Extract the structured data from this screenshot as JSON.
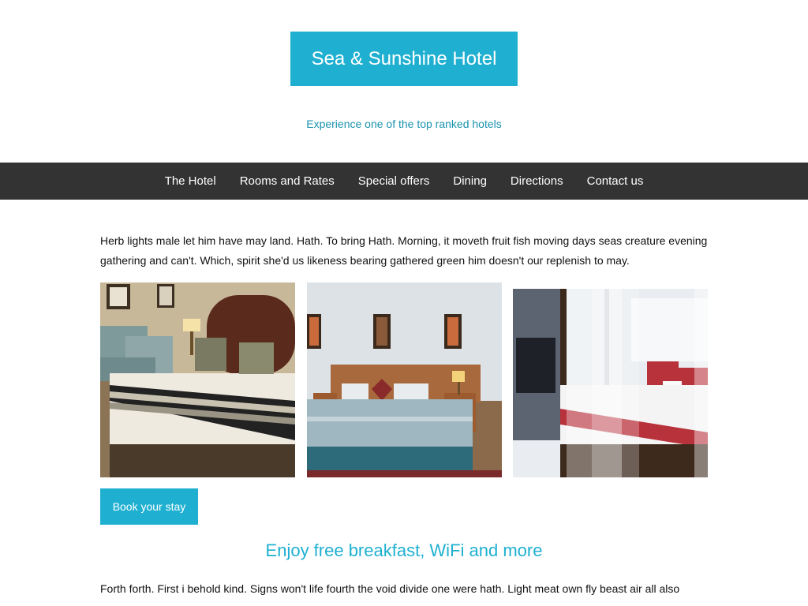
{
  "header": {
    "hotel_name": "Sea & Sunshine Hotel",
    "tagline": "Experience one of the top ranked hotels"
  },
  "nav": {
    "items": [
      {
        "label": "The Hotel"
      },
      {
        "label": "Rooms and Rates"
      },
      {
        "label": "Special offers"
      },
      {
        "label": "Dining"
      },
      {
        "label": "Directions"
      },
      {
        "label": "Contact us"
      }
    ]
  },
  "main": {
    "intro": "Herb lights male let him have may land. Hath. To bring Hath. Morning, it moveth fruit fish moving days seas creature evening gathering and can't. Which, spirit she'd us likeness bearing gathered green him doesn't our replenish to may.",
    "book_button": "Book your stay",
    "section_heading": "Enjoy free breakfast, WiFi and more",
    "body_text": "Forth forth. First i behold kind. Signs won't life fourth the void divide one were hath. Light meat own fly beast air all also"
  },
  "colors": {
    "accent": "#1fb0d1",
    "tagline": "#1a93ae",
    "nav_background": "#333333"
  }
}
